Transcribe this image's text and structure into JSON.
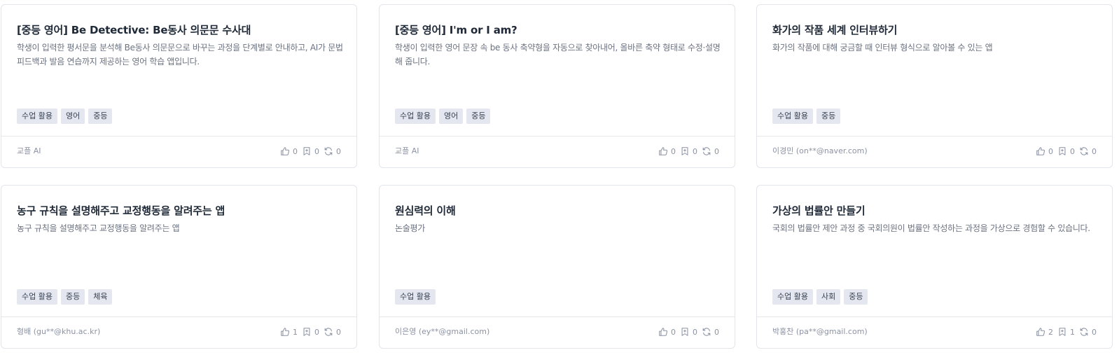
{
  "cards": [
    {
      "title": "[중등 영어] Be Detective: Be동사 의문문 수사대",
      "description": "학생이 입력한 평서문을 분석해 Be동사 의문문으로 바꾸는 과정을 단계별로 안내하고, AI가 문법 피드백과 발음 연습까지 제공하는 영어 학습 앱입니다.",
      "tags": [
        "수업 활용",
        "영어",
        "중등"
      ],
      "author": "교플 AI",
      "likes": "0",
      "bookmarks": "0",
      "remixes": "0"
    },
    {
      "title": "[중등 영어] I'm or I am?",
      "description": "학생이 입력한 영어 문장 속 be 동사 축약형을 자동으로 찾아내어, 올바른 축약 형태로 수정·설명해 줍니다.",
      "tags": [
        "수업 활용",
        "영어",
        "중등"
      ],
      "author": "교플 AI",
      "likes": "0",
      "bookmarks": "0",
      "remixes": "0"
    },
    {
      "title": "화가의 작품 세계 인터뷰하기",
      "description": "화가의 작품에 대해 궁금할 때 인터뷰 형식으로 알아볼 수 있는 앱",
      "tags": [
        "수업 활용",
        "중등"
      ],
      "author": "이경민 (on**@naver.com)",
      "likes": "0",
      "bookmarks": "0",
      "remixes": "0"
    },
    {
      "title": "농구 규칙을 설명해주고 교정행동을 알려주는 앱",
      "description": "농구 규칙을 설명해주고 교정행동을 알려주는 앱",
      "tags": [
        "수업 활용",
        "중등",
        "체육"
      ],
      "author": "형배 (gu**@khu.ac.kr)",
      "likes": "1",
      "bookmarks": "0",
      "remixes": "0"
    },
    {
      "title": "원심력의 이해",
      "description": "논술평가",
      "tags": [
        "수업 활용"
      ],
      "author": "이은영 (ey**@gmail.com)",
      "likes": "0",
      "bookmarks": "0",
      "remixes": "0"
    },
    {
      "title": "가상의 법률안 만들기",
      "description": "국회의 법률안 제안 과정 중 국회의원이 법률안 작성하는 과정을 가상으로 경험할 수 있습니다.",
      "tags": [
        "수업 활용",
        "사회",
        "중등"
      ],
      "author": "박홍찬 (pa**@gmail.com)",
      "likes": "2",
      "bookmarks": "1",
      "remixes": "0"
    }
  ],
  "icons": {
    "like": "thumbs-up-icon",
    "bookmark": "bookmark-icon",
    "remix": "refresh-icon"
  },
  "colors": {
    "tag_background": "#e5e7f0",
    "muted_text": "#8b92a3",
    "border": "#e2e5ea"
  }
}
